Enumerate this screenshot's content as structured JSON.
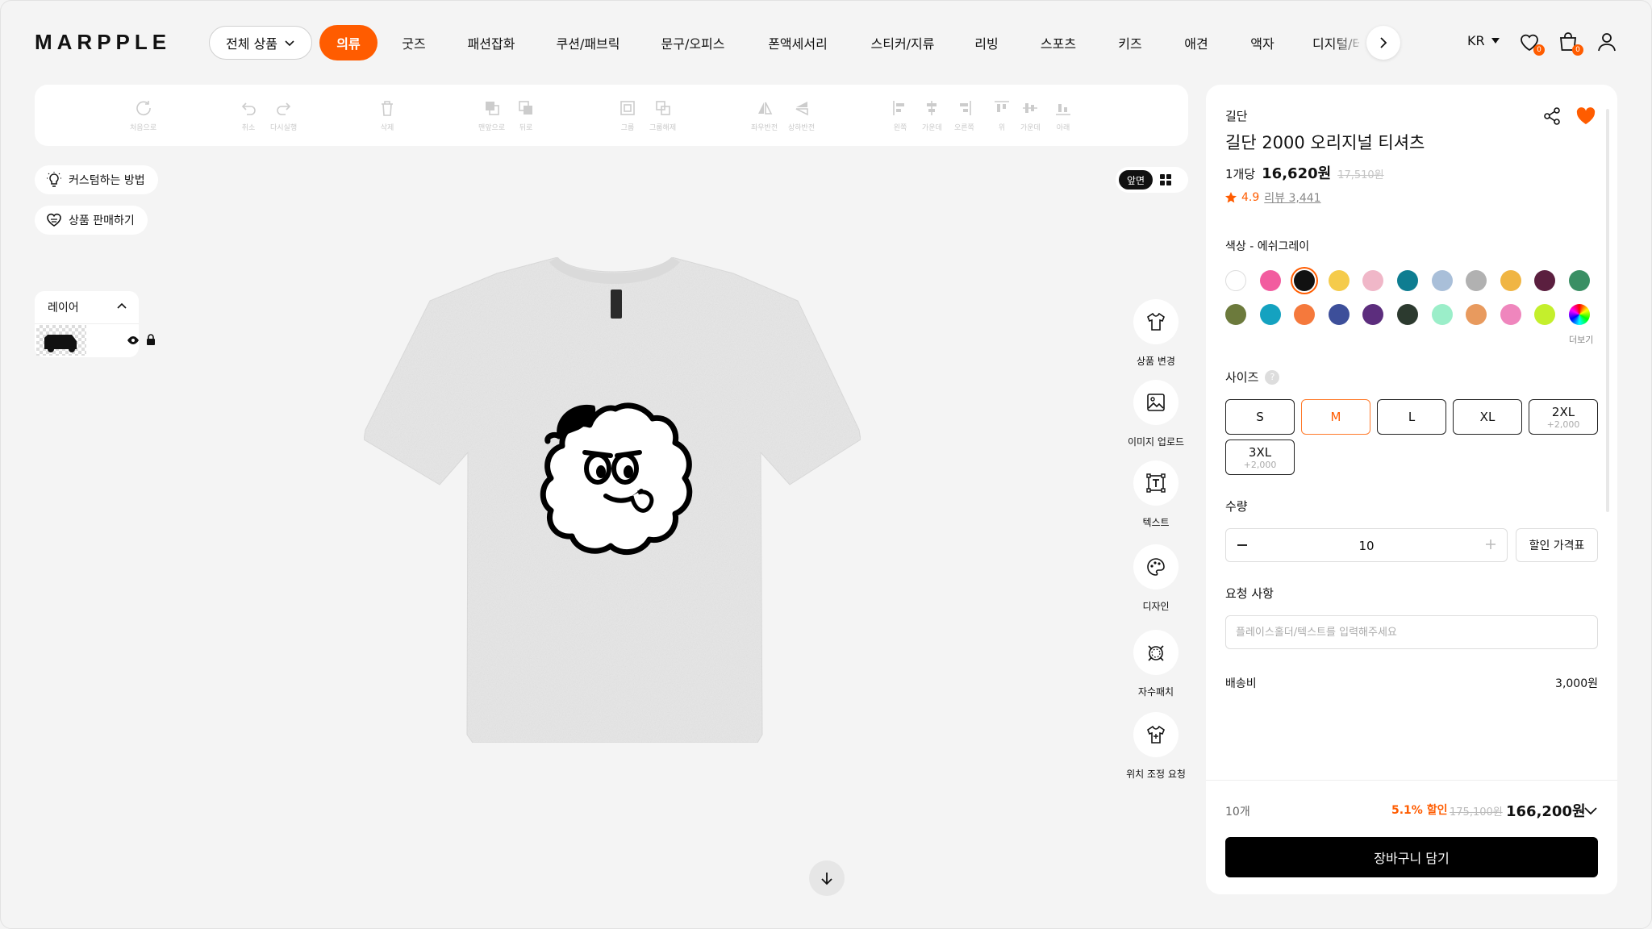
{
  "nav": {
    "logo": "MARPPLE",
    "all_products": "전체 상품",
    "categories": [
      "의류",
      "굿즈",
      "패션잡화",
      "쿠션/패브릭",
      "문구/오피스",
      "폰액세서리",
      "스티커/지류",
      "리빙",
      "스포츠",
      "키즈",
      "애견",
      "액자",
      "디지털/테"
    ],
    "lang": "KR",
    "wish_count": "0",
    "cart_count": "0"
  },
  "toolbar": [
    "처음으로",
    "취소",
    "다시실행",
    "삭제",
    "맨앞으로",
    "뒤로",
    "그룹",
    "그룹해제",
    "좌우반전",
    "상하반전",
    "왼쪽",
    "가운데",
    "오른쪽",
    "위",
    "가운데",
    "아래"
  ],
  "left": {
    "howto": "커스텀하는 방법",
    "sell": "상품 판매하기",
    "layers_title": "레이어"
  },
  "view": {
    "front": "앞면"
  },
  "right_tools": [
    "상품 변경",
    "이미지 업로드",
    "텍스트",
    "디자인",
    "자수패치",
    "위치 조정 요청"
  ],
  "product": {
    "brand": "길단",
    "title": "길단 2000 오리지널 티셔츠",
    "unit_label": "1개당",
    "price": "16,620원",
    "old_price": "17,510원",
    "rating": "4.9",
    "reviews": "리뷰 3,441",
    "color_label": "색상 - 에쉬그레이",
    "more_colors": "더보기",
    "size_label": "사이즈",
    "size_help": "?",
    "sizes": [
      {
        "label": "S",
        "extra": ""
      },
      {
        "label": "M",
        "extra": ""
      },
      {
        "label": "L",
        "extra": ""
      },
      {
        "label": "XL",
        "extra": ""
      },
      {
        "label": "2XL",
        "extra": "+2,000"
      },
      {
        "label": "3XL",
        "extra": "+2,000"
      }
    ],
    "qty_label": "수량",
    "qty": "10",
    "discount_table": "할인 가격표",
    "request_label": "요청 사항",
    "request_placeholder": "플레이스홀더/텍스트를 입력해주세요",
    "shipping_label": "배송비",
    "shipping_value": "3,000원"
  },
  "colors": {
    "row1": [
      "#ffffff",
      "#f25c9f",
      "#111111",
      "#f5cb4b",
      "#f0b7c8",
      "#0e7d91",
      "#a9bfd9",
      "#b1b1b1",
      "#f0b543",
      "#5b1f3f",
      "#3a8f64"
    ],
    "row2": [
      "#6c7a3c",
      "#14a2c0",
      "#f5793c",
      "#3d4f9a",
      "#5c2d7d",
      "#2c3a2f",
      "#9beec9",
      "#e89a5e",
      "#ef86bd",
      "#c4ef2c",
      "conic"
    ],
    "accent": "#ff5c00"
  },
  "summary": {
    "count": "10개",
    "discount": "5.1% 할인",
    "old_total": "175,100원",
    "total": "166,200원",
    "cart": "장바구니 담기"
  }
}
